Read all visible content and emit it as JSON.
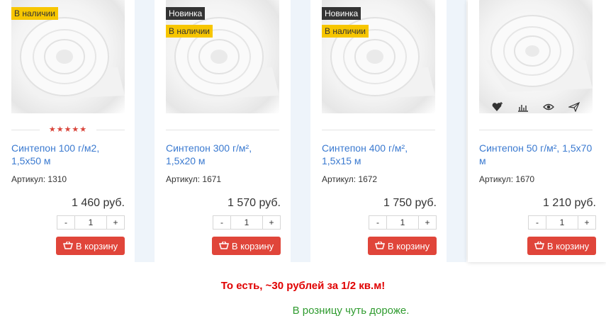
{
  "products": [
    {
      "badges": [
        {
          "text": "В наличии",
          "kind": "stock"
        }
      ],
      "rating_stars": "★★★★★",
      "title": "Синтепон 100 г/м2, 1,5х50 м",
      "sku": "Артикул:  1310",
      "price": "1 460 руб.",
      "qty": "1",
      "cart_label": "В корзину"
    },
    {
      "badges": [
        {
          "text": "Новинка",
          "kind": "new"
        },
        {
          "text": "В наличии",
          "kind": "stock"
        }
      ],
      "title": "Синтепон 300 г/м², 1,5х20 м",
      "sku": "Артикул:  1671",
      "price": "1 570 руб.",
      "qty": "1",
      "cart_label": "В корзину"
    },
    {
      "badges": [
        {
          "text": "Новинка",
          "kind": "new"
        },
        {
          "text": "В наличии",
          "kind": "stock"
        }
      ],
      "title": "Синтепон 400 г/м², 1,5х15 м",
      "sku": "Артикул:  1672",
      "price": "1 750 руб.",
      "qty": "1",
      "cart_label": "В корзину"
    },
    {
      "badges": [],
      "title": "Синтепон 50 г/м², 1,5х70 м",
      "sku": "Артикул:  1670",
      "price": "1 210 руб.",
      "qty": "1",
      "cart_label": "В корзину",
      "action_icons": [
        "heart-plus-icon",
        "compare-chart-icon",
        "eye-icon",
        "send-icon"
      ]
    }
  ],
  "qty_minus": "-",
  "qty_plus": "+",
  "note_red": "То есть, ~30 рублей за 1/2 кв.м!",
  "note_green": "В розницу чуть дороже.",
  "colors": {
    "stock_badge": "#f7c600",
    "new_badge": "#333333",
    "link": "#3b7ad0",
    "cart_button": "#e0453a",
    "note_red": "#e00000",
    "note_green": "#2f9b2f"
  }
}
